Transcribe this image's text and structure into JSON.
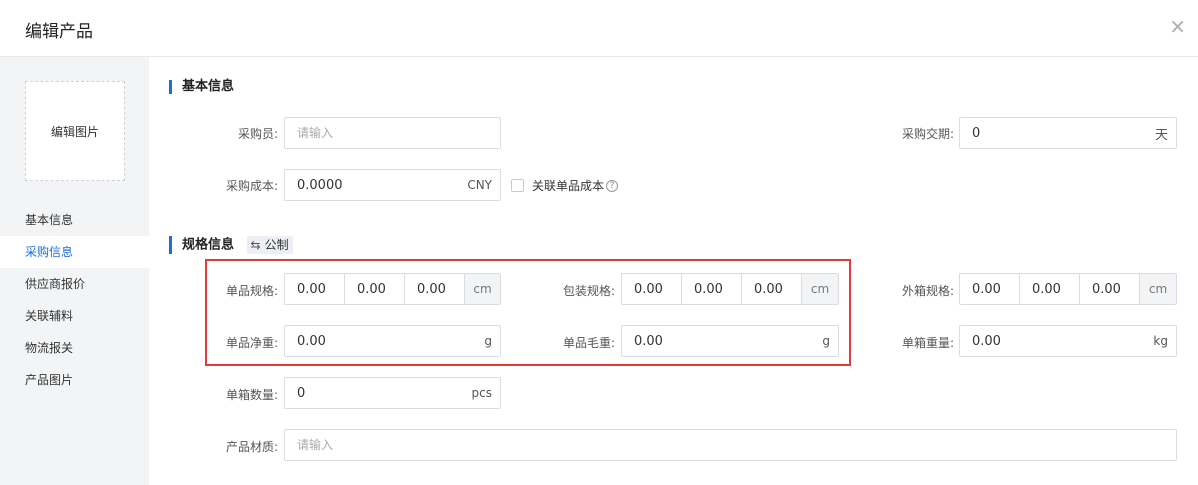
{
  "header": {
    "title": "编辑产品",
    "close_icon": "close-icon"
  },
  "sidebar": {
    "image_label": "编辑图片",
    "items": [
      {
        "label": "基本信息",
        "active": false
      },
      {
        "label": "采购信息",
        "active": true
      },
      {
        "label": "供应商报价",
        "active": false
      },
      {
        "label": "关联辅料",
        "active": false
      },
      {
        "label": "物流报关",
        "active": false
      },
      {
        "label": "产品图片",
        "active": false
      }
    ]
  },
  "basic": {
    "section_title": "基本信息",
    "buyer": {
      "label": "采购员:",
      "placeholder": "请输入",
      "value": ""
    },
    "lead_time": {
      "label": "采购交期:",
      "value": "0",
      "unit": "天"
    },
    "cost": {
      "label": "采购成本:",
      "value": "0.0000",
      "unit": "CNY"
    },
    "link_cost": {
      "label": "关联单品成本",
      "checked": false,
      "help_icon": "help-icon"
    }
  },
  "spec": {
    "section_title": "规格信息",
    "unit_toggle": {
      "label": "公制",
      "icon": "swap-icon"
    },
    "item_size": {
      "label": "单品规格:",
      "values": [
        "0.00",
        "0.00",
        "0.00"
      ],
      "unit": "cm"
    },
    "package_size": {
      "label": "包装规格:",
      "values": [
        "0.00",
        "0.00",
        "0.00"
      ],
      "unit": "cm"
    },
    "carton_size": {
      "label": "外箱规格:",
      "values": [
        "0.00",
        "0.00",
        "0.00"
      ],
      "unit": "cm"
    },
    "net_weight": {
      "label": "单品净重:",
      "value": "0.00",
      "unit": "g"
    },
    "gross_weight": {
      "label": "单品毛重:",
      "value": "0.00",
      "unit": "g"
    },
    "carton_weight": {
      "label": "单箱重量:",
      "value": "0.00",
      "unit": "kg"
    },
    "carton_qty": {
      "label": "单箱数量:",
      "value": "0",
      "unit": "pcs"
    },
    "material": {
      "label": "产品材质:",
      "placeholder": "请输入",
      "value": ""
    }
  },
  "colors": {
    "accent": "#1f6fd6",
    "highlight": "#e03a3a"
  }
}
